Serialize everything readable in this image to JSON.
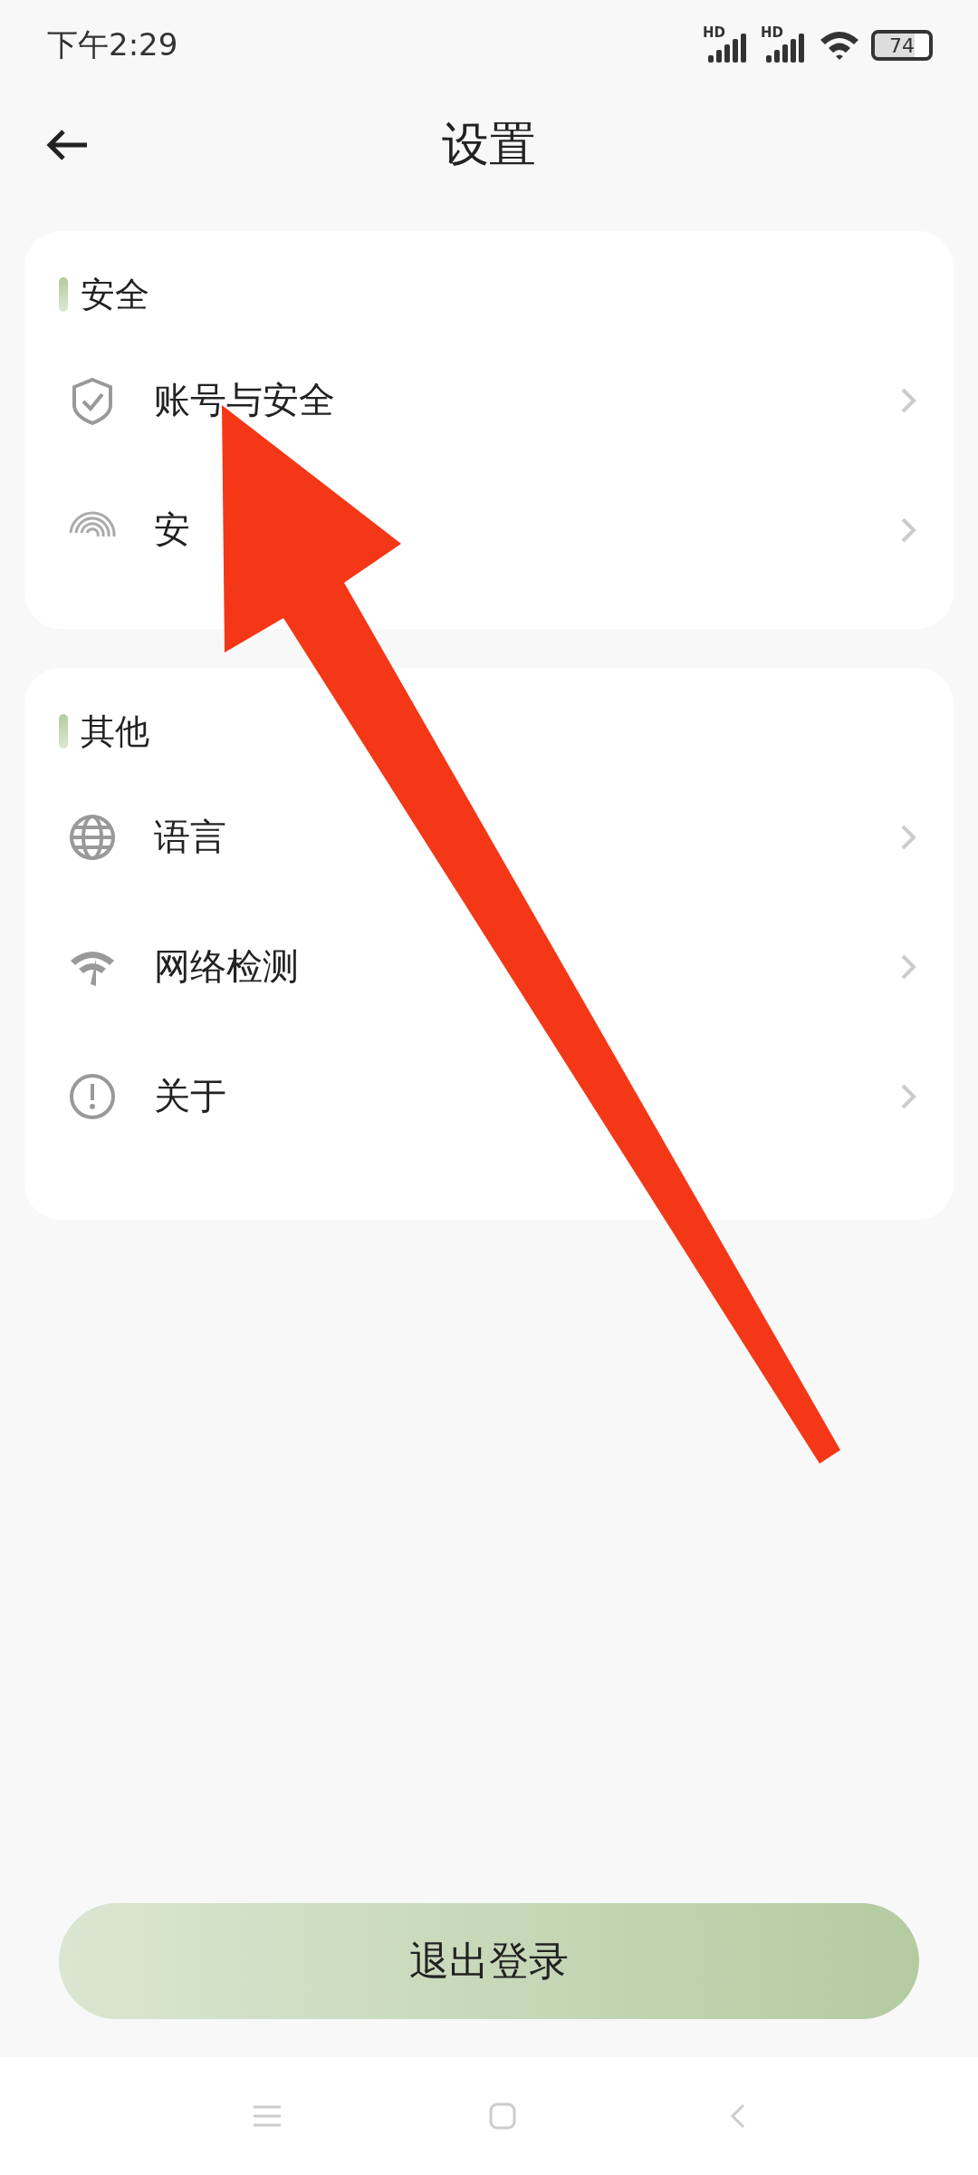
{
  "status_bar": {
    "time": "下午2:29",
    "battery": "74",
    "signal_labels": [
      "HD",
      "HD"
    ]
  },
  "header": {
    "title": "设置"
  },
  "sections": [
    {
      "title": "安全",
      "items": [
        {
          "label": "账号与安全"
        },
        {
          "label": "安"
        }
      ]
    },
    {
      "title": "其他",
      "items": [
        {
          "label": "语言"
        },
        {
          "label": "网络检测"
        },
        {
          "label": "关于"
        }
      ]
    }
  ],
  "logout_button": "退出登录"
}
